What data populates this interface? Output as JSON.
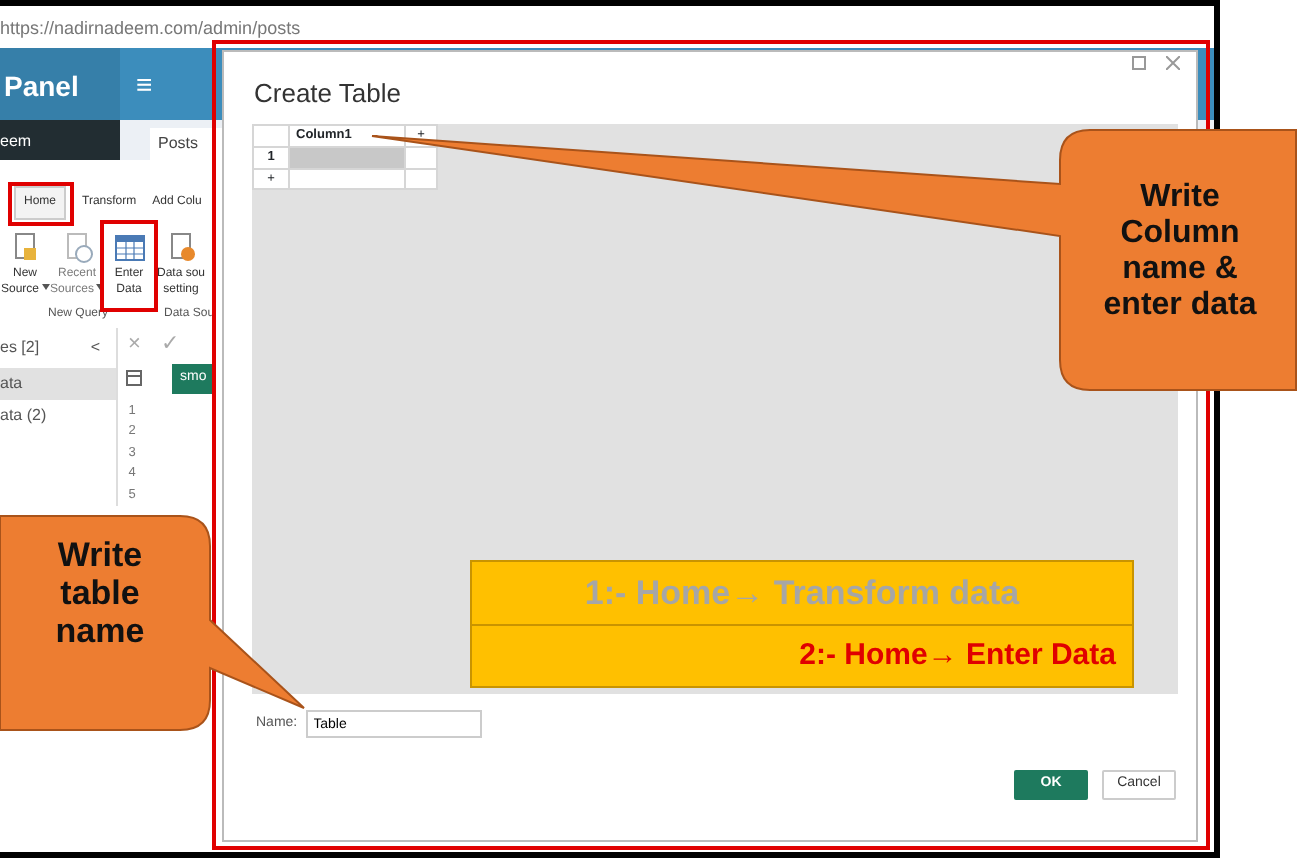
{
  "browser": {
    "url": "https://nadirnadeem.com/admin/posts"
  },
  "app": {
    "brand": "Panel",
    "menu_glyph": "≡",
    "user": "eem",
    "page_tab": "Posts"
  },
  "ribbon": {
    "tabs": [
      {
        "label": "Home",
        "selected": true
      },
      {
        "label": "Transform",
        "selected": false
      },
      {
        "label": "Add Colu",
        "selected": false
      }
    ],
    "buttons": [
      {
        "lines": [
          "New",
          "Source"
        ],
        "kind": "file",
        "dropdown": true,
        "disabled": false
      },
      {
        "lines": [
          "Recent",
          "Sources"
        ],
        "kind": "recent",
        "dropdown": true,
        "disabled": true
      },
      {
        "lines": [
          "Enter",
          "Data"
        ],
        "kind": "table",
        "dropdown": false,
        "disabled": false
      },
      {
        "lines": [
          "Data sou",
          "setting"
        ],
        "kind": "settings",
        "dropdown": false,
        "disabled": false
      }
    ],
    "groups": [
      "New Query",
      "Data Sou"
    ]
  },
  "queries": {
    "title": "es [2]",
    "collapse_glyph": "<",
    "items": [
      {
        "label": "ata",
        "selected": true
      },
      {
        "label": "ata (2)",
        "selected": false
      }
    ]
  },
  "formula_bar": {
    "cancel_glyph": "×",
    "confirm_glyph": "✓"
  },
  "grid": {
    "column": "smo",
    "row_numbers": [
      "1",
      "2",
      "3",
      "4",
      "5"
    ]
  },
  "dialog": {
    "title": "Create Table",
    "table": {
      "columns": [
        "Column1"
      ],
      "add_column_glyph": "+",
      "rows": [
        {
          "number": "1",
          "selected": true
        }
      ],
      "add_row_glyph": "+"
    },
    "name_label": "Name:",
    "name_value": "Table",
    "buttons": [
      {
        "label": "OK",
        "kind": "primary"
      },
      {
        "label": "Cancel",
        "kind": "secondary"
      }
    ]
  },
  "annotations": {
    "callouts": [
      {
        "lines": [
          "Write",
          "Column",
          "name &",
          "enter data"
        ]
      },
      {
        "lines": [
          "Write",
          "table",
          "name"
        ]
      }
    ],
    "steps": [
      {
        "text": "1:- Home→ Transform data",
        "color": "#a6a6a6"
      },
      {
        "text": "2:- Home→ Enter Data",
        "color": "#e00000"
      }
    ]
  }
}
